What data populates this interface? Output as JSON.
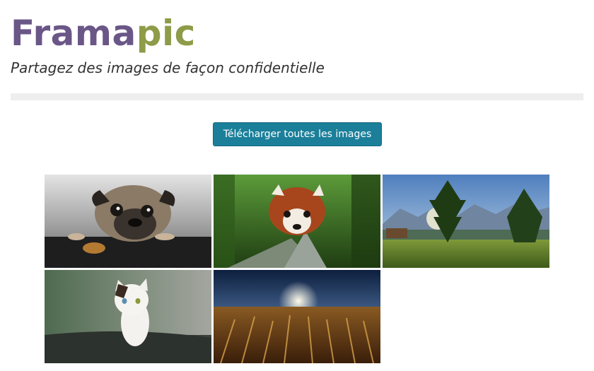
{
  "header": {
    "brand_part1": "Frama",
    "brand_part2": "pic",
    "tagline": "Partagez des images de façon confidentielle"
  },
  "actions": {
    "download_all_label": "Télécharger toutes les images"
  },
  "colors": {
    "brand_purple": "#6a5687",
    "brand_green": "#8e9b48",
    "button_bg": "#1b7f9a"
  }
}
